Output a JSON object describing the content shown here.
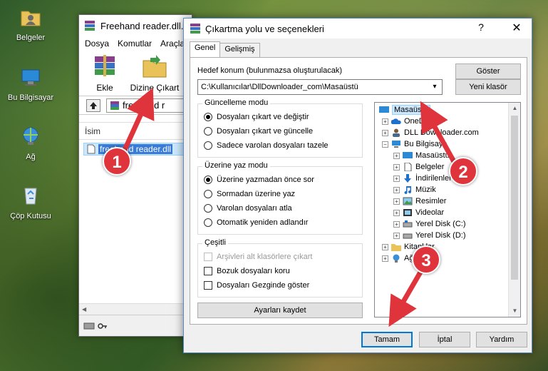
{
  "desktop": {
    "icons": [
      {
        "label": "Belgeler",
        "icon": "folder-user-icon"
      },
      {
        "label": "Bu Bilgisayar",
        "icon": "computer-icon"
      },
      {
        "label": "Ağ",
        "icon": "network-icon"
      },
      {
        "label": "Çöp Kutusu",
        "icon": "recycle-bin-icon"
      }
    ]
  },
  "main_window": {
    "title": "Freehand reader.dll.z",
    "menu": [
      "Dosya",
      "Komutlar",
      "Araçla"
    ],
    "toolbar": {
      "add_label": "Ekle",
      "extract_label": "Dizine Çıkart"
    },
    "path_text": "freehand r",
    "column_name": "İsim",
    "file_name": "freehand reader.dll"
  },
  "dialog": {
    "title": "Çıkartma yolu ve seçenekleri",
    "help_glyph": "?",
    "close_glyph": "✕",
    "tabs": [
      "Genel",
      "Gelişmiş"
    ],
    "target_label": "Hedef konum (bulunmazsa oluşturulacak)",
    "target_value": "C:\\Kullanıcılar\\DllDownloader_com\\Masaüstü",
    "show_button": "Göster",
    "new_folder_button": "Yeni klasör",
    "update_group": {
      "title": "Güncelleme modu",
      "options": [
        "Dosyaları çıkart ve değiştir",
        "Dosyaları çıkart ve güncelle",
        "Sadece varolan dosyaları tazele"
      ],
      "selected": 0
    },
    "overwrite_group": {
      "title": "Üzerine yaz modu",
      "options": [
        "Üzerine yazmadan önce sor",
        "Sormadan üzerine yaz",
        "Varolan dosyaları atla",
        "Otomatik yeniden adlandır"
      ],
      "selected": 0
    },
    "misc_group": {
      "title": "Çeşitli",
      "options": [
        {
          "label": "Arşivleri alt klasörlere çıkart",
          "checked": false,
          "disabled": true
        },
        {
          "label": "Bozuk dosyaları koru",
          "checked": false,
          "disabled": false
        },
        {
          "label": "Dosyaları Gezginde göster",
          "checked": false,
          "disabled": false
        }
      ]
    },
    "save_settings_button": "Ayarları kaydet",
    "tree": [
      {
        "label": "Masaüstü",
        "icon": "desktop-folder-icon",
        "selected": true
      },
      {
        "label": "OneD",
        "icon": "cloud-icon"
      },
      {
        "label": "DLL Downloader.com",
        "icon": "user-icon"
      },
      {
        "label": "Bu Bilgisaya",
        "icon": "computer-icon"
      },
      {
        "label": "Masaüstü",
        "icon": "desktop-folder-icon"
      },
      {
        "label": "Belgeler",
        "icon": "document-icon"
      },
      {
        "label": "İndirilenler",
        "icon": "download-icon"
      },
      {
        "label": "Müzik",
        "icon": "music-icon"
      },
      {
        "label": "Resimler",
        "icon": "pictures-icon"
      },
      {
        "label": "Videolar",
        "icon": "video-icon"
      },
      {
        "label": "Yerel Disk (C:)",
        "icon": "drive-icon"
      },
      {
        "label": "Yerel Disk (D:)",
        "icon": "drive-icon"
      },
      {
        "label": "Kitapl lar",
        "icon": "library-icon"
      },
      {
        "label": "Ağ",
        "icon": "network-icon"
      }
    ],
    "ok_button": "Tamam",
    "cancel_button": "İptal",
    "help_button": "Yardım"
  },
  "annotations": [
    "1",
    "2",
    "3"
  ],
  "colors": {
    "marker": "#e0343c",
    "selection": "#cce8ff",
    "accent": "#0078d7"
  }
}
